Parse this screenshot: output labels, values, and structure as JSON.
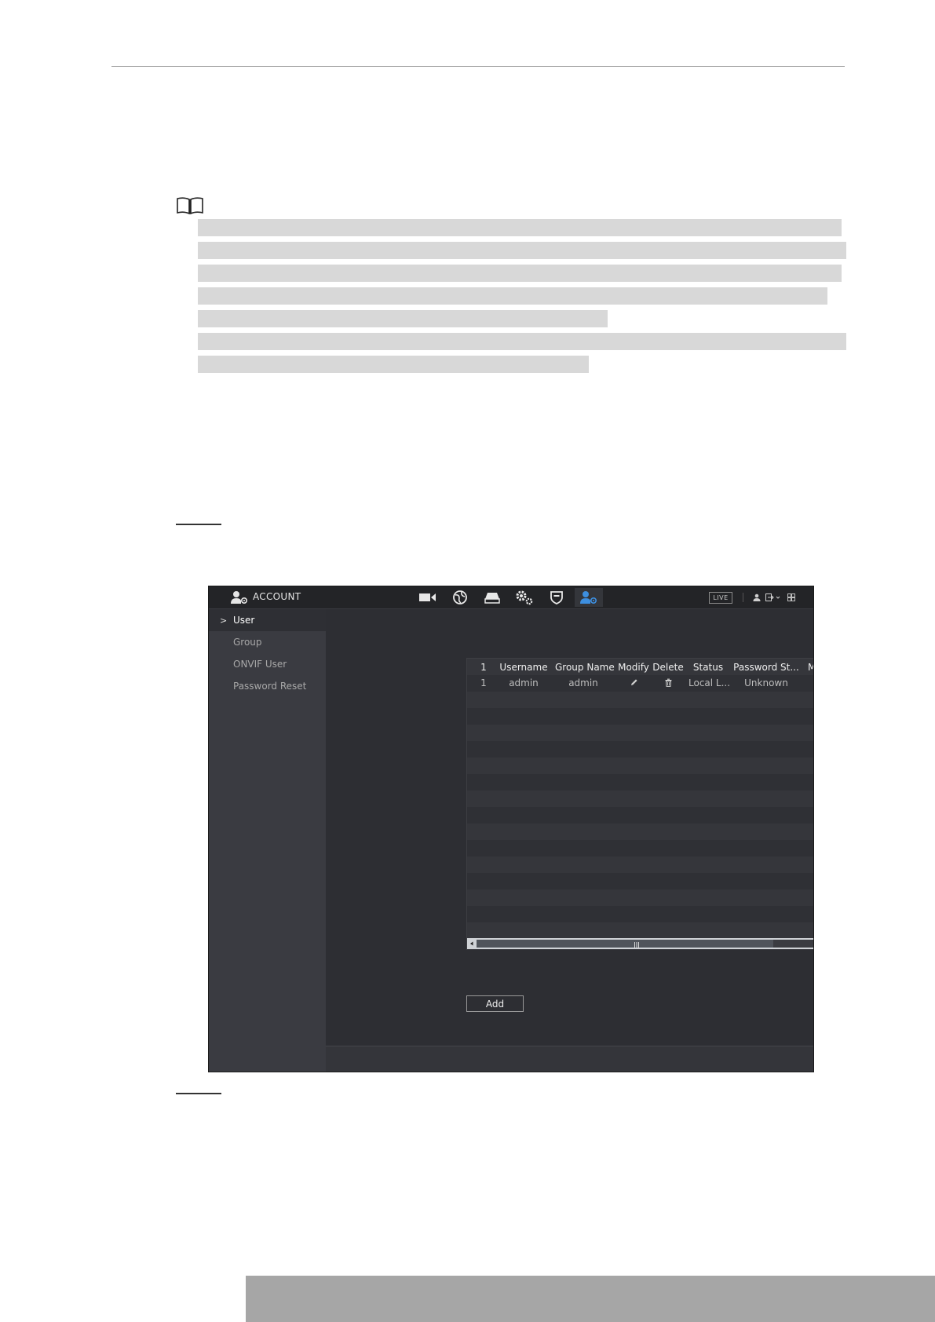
{
  "window": {
    "title": "ACCOUNT",
    "live_badge": "LIVE",
    "nav_icons": [
      "camera-icon",
      "network-globe-icon",
      "storage-icon",
      "system-settings-icon",
      "security-shield-icon",
      "account-icon"
    ],
    "active_nav": "account-icon",
    "header_right_icons": [
      "user-icon",
      "logout-icon",
      "chevron-down-icon",
      "grid-layout-icon"
    ]
  },
  "sidebar": {
    "items": [
      {
        "label": "User",
        "active": true
      },
      {
        "label": "Group",
        "active": false
      },
      {
        "label": "ONVIF User",
        "active": false
      },
      {
        "label": "Password Reset",
        "active": false
      }
    ],
    "chevron": ">"
  },
  "table": {
    "columns": [
      "1",
      "Username",
      "Group Name",
      "Modify",
      "Delete",
      "Status",
      "Password St...",
      "MAC Addres"
    ],
    "rows": [
      {
        "index": "1",
        "username": "admin",
        "group": "admin",
        "status": "Local L...",
        "password_strength": "Unknown",
        "mac": ""
      }
    ]
  },
  "buttons": {
    "add": "Add"
  },
  "colors": {
    "accent": "#3d8fe0",
    "background": "#2b2c30",
    "sidebar": "#3a3b41"
  }
}
